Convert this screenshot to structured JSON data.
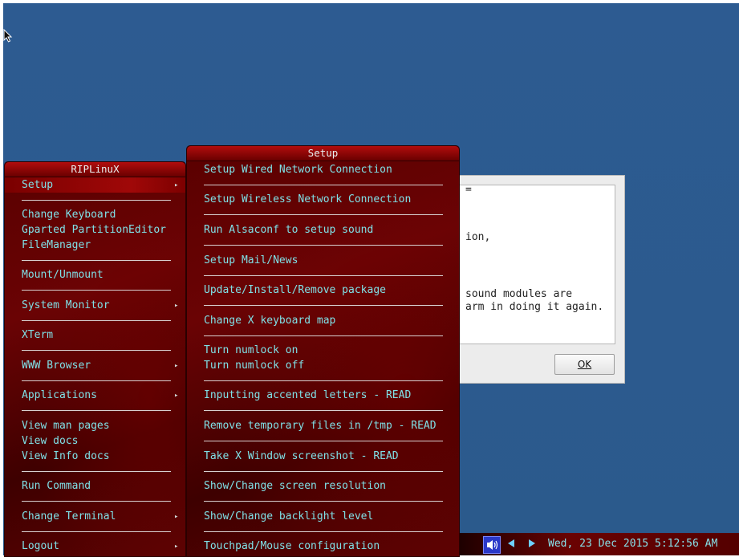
{
  "dialog": {
    "lines": [
      "=",
      "ion,",
      "sound modules are",
      "arm in doing it again."
    ],
    "ok_label": "OK"
  },
  "main_menu": {
    "title": "RIPLinuX",
    "items": [
      {
        "label": "Setup",
        "submenu": true
      },
      {
        "label": "Change Keyboard"
      },
      {
        "label": "Gparted PartitionEditor"
      },
      {
        "label": "FileManager"
      },
      {
        "label": "Mount/Unmount"
      },
      {
        "label": "System Monitor",
        "submenu": true
      },
      {
        "label": "XTerm"
      },
      {
        "label": "WWW Browser",
        "submenu": true
      },
      {
        "label": "Applications",
        "submenu": true
      },
      {
        "label": "View man pages"
      },
      {
        "label": "View docs"
      },
      {
        "label": "View Info docs"
      },
      {
        "label": "Run Command"
      },
      {
        "label": "Change Terminal",
        "submenu": true
      },
      {
        "label": "Logout",
        "submenu": true
      }
    ],
    "submenu_arrow": "▸"
  },
  "setup_menu": {
    "title": "Setup",
    "items": [
      "Setup Wired Network Connection",
      "Setup Wireless Network Connection",
      "Run Alsaconf to setup sound",
      "Setup Mail/News",
      "Update/Install/Remove package",
      "Change X keyboard map",
      "Turn numlock on",
      "Turn numlock off",
      "Inputting accented letters - READ",
      "Remove temporary files in /tmp - READ",
      "Take X Window screenshot - READ",
      "Show/Change screen resolution",
      "Show/Change backlight level",
      "Touchpad/Mouse configuration"
    ]
  },
  "taskbar": {
    "clock": "Wed, 23 Dec 2015   5:12:56 AM",
    "icons": [
      "volume-icon",
      "arrow-left-icon",
      "arrow-right-icon"
    ]
  }
}
